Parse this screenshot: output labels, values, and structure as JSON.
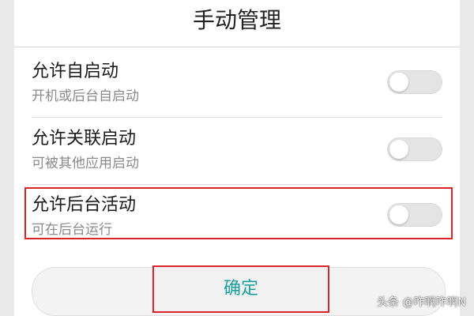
{
  "dialog": {
    "title": "手动管理",
    "items": [
      {
        "label": "允许自启动",
        "description": "开机或后台自启动",
        "enabled": false
      },
      {
        "label": "允许关联启动",
        "description": "可被其他应用启动",
        "enabled": false
      },
      {
        "label": "允许后台活动",
        "description": "可在后台运行",
        "enabled": false
      }
    ],
    "confirm_label": "确定"
  },
  "watermark": "头条 @咋啊咋啊N",
  "colors": {
    "highlight": "#d9252a",
    "confirm_text": "#1aa0a0",
    "toggle_off": "#e4e4e4"
  }
}
